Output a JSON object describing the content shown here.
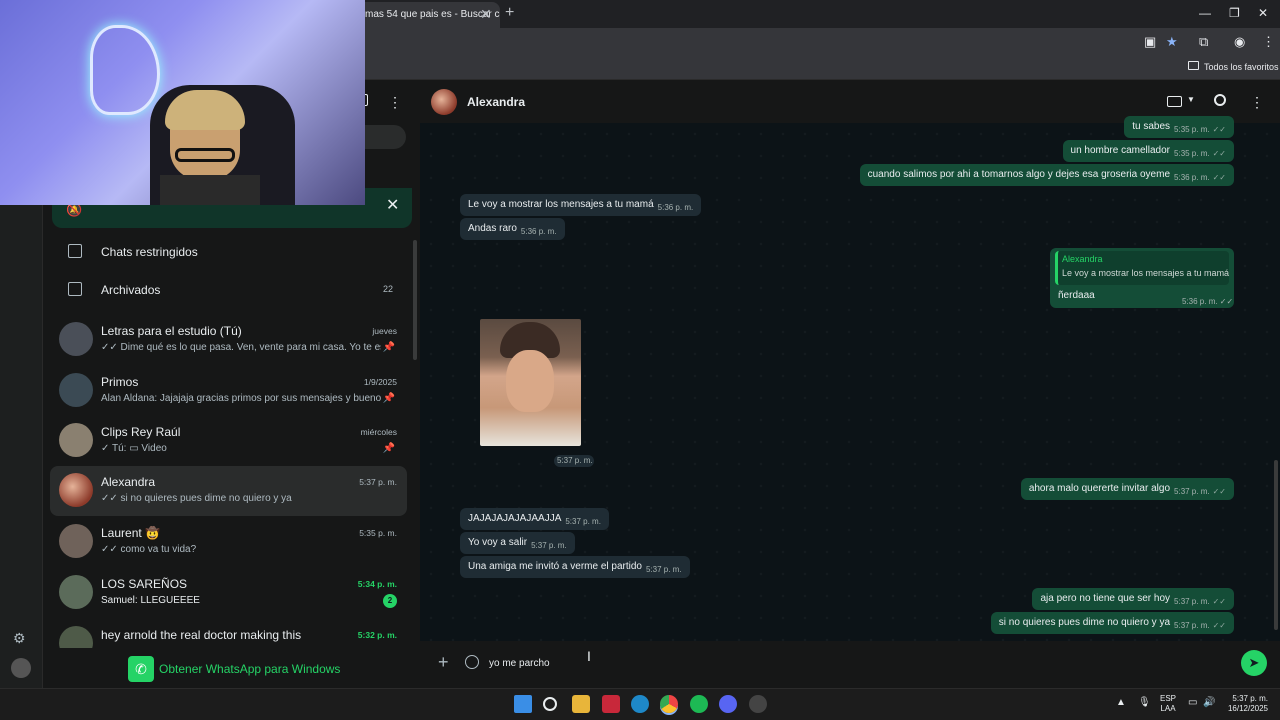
{
  "browser": {
    "tab_title": "mas 54 que pais es - Buscar co",
    "bookmarks_label": "Todos los favoritos"
  },
  "sidebar": {
    "restricted_label": "Chats restringidos",
    "archived_label": "Archivados",
    "archived_count": "22",
    "chats": [
      {
        "name": "Letras para el estudio (Tú)",
        "time": "jueves",
        "preview": "✓✓ Dime qué es lo que pasa. Ven, vente para mi casa. Yo te esper...",
        "pinned": true,
        "unread": ""
      },
      {
        "name": "Primos",
        "time": "1/9/2025",
        "preview": "Alan Aldana: Jajajaja gracias primos por sus mensajes y buenos ...",
        "pinned": true,
        "unread": ""
      },
      {
        "name": "Clips Rey Raúl",
        "time": "miércoles",
        "preview": "✓ Tú: ▭ Video",
        "pinned": true,
        "unread": ""
      },
      {
        "name": "Alexandra",
        "time": "5:37 p. m.",
        "preview": "✓✓ si no quieres pues dime no quiero y ya",
        "pinned": false,
        "unread": ""
      },
      {
        "name": "Laurent 🤠",
        "time": "5:35 p. m.",
        "preview": "✓✓ como va tu vida?",
        "pinned": false,
        "unread": ""
      },
      {
        "name": "LOS SAREÑOS",
        "time": "5:34 p. m.",
        "preview": "Samuel: LLEGUEEEE",
        "pinned": false,
        "unread": "2"
      },
      {
        "name": "hey arnold the real doctor making this",
        "time": "5:32 p. m.",
        "preview": "",
        "pinned": false,
        "unread": ""
      }
    ],
    "get_whatsapp_label": "Obtener WhatsApp para Windows"
  },
  "chat": {
    "contact_name": "Alexandra",
    "messages": [
      {
        "dir": "out",
        "text": "tu sabes",
        "time": "5:35 p. m."
      },
      {
        "dir": "out",
        "text": "un hombre camellador",
        "time": "5:35 p. m."
      },
      {
        "dir": "out",
        "text": "cuando salimos por ahi a tomarnos algo y dejes esa groseria oyeme",
        "time": "5:36 p. m."
      },
      {
        "dir": "in",
        "text": "Le voy a mostrar los mensajes a tu mamá",
        "time": "5:36 p. m."
      },
      {
        "dir": "in",
        "text": "Andas raro",
        "time": "5:36 p. m."
      },
      {
        "dir": "in",
        "text": "",
        "time": "5:37 p. m."
      },
      {
        "dir": "out",
        "text": "ahora malo quererte invitar algo",
        "time": "5:37 p. m."
      },
      {
        "dir": "in",
        "text": "JAJAJAJAJAJAAJJA",
        "time": "5:37 p. m."
      },
      {
        "dir": "in",
        "text": "Yo voy a salir",
        "time": "5:37 p. m."
      },
      {
        "dir": "in",
        "text": "Una amiga me invitó a verme el partido",
        "time": "5:37 p. m."
      },
      {
        "dir": "out",
        "text": "aja pero no tiene que ser hoy",
        "time": "5:37 p. m."
      },
      {
        "dir": "out",
        "text": "si no quieres pues dime no quiero y ya",
        "time": "5:37 p. m."
      }
    ],
    "reply": {
      "quoted_author": "Alexandra",
      "quoted_text": "Le voy a mostrar los mensajes a tu mamá",
      "text": "ñerdaaa",
      "time": "5:36 p. m."
    },
    "photo_time": "5:37 p. m.",
    "compose_value": "yo me parcho"
  },
  "taskbar": {
    "lang_line1": "ESP",
    "lang_line2": "LAA",
    "time": "5:37 p. m.",
    "date": "16/12/2025"
  },
  "colors": {
    "accent": "#25d366",
    "outgoing_bubble": "#144d37",
    "incoming_bubble": "#1f2c34",
    "chat_bg": "#0c1317"
  }
}
